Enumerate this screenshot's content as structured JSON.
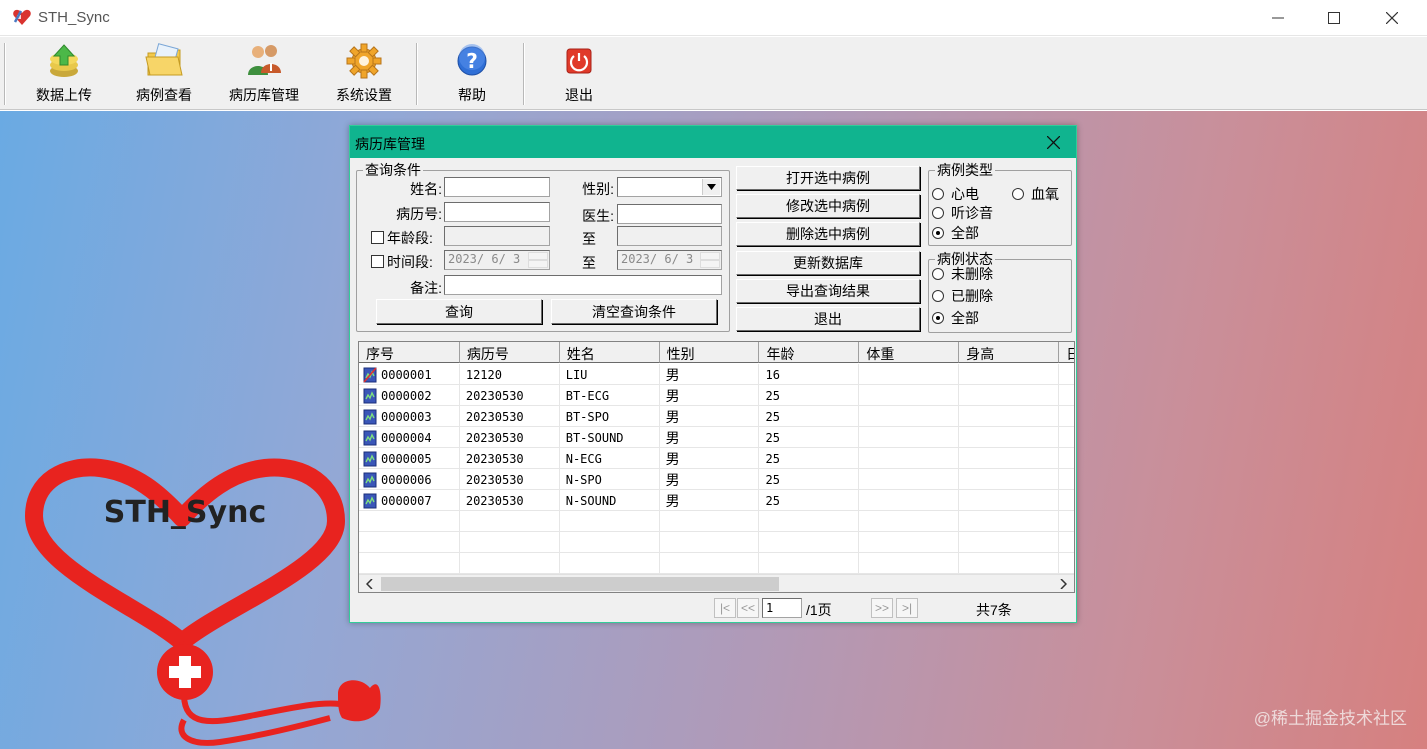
{
  "window": {
    "title": "STH_Sync"
  },
  "toolbar": {
    "upload": "数据上传",
    "view_cases": "病例查看",
    "records_mgmt": "病历库管理",
    "settings": "系统设置",
    "help": "帮助",
    "exit": "退出"
  },
  "logo": {
    "text": "STH_Sync"
  },
  "watermark": "@稀土掘金技术社区",
  "dialog": {
    "title": "病历库管理",
    "query": {
      "legend": "查询条件",
      "name_label": "姓名:",
      "name_value": "",
      "gender_label": "性别:",
      "gender_value": "",
      "record_no_label": "病历号:",
      "record_no_value": "",
      "doctor_label": "医生:",
      "doctor_value": "",
      "age_range_label": "年龄段:",
      "age_to_label": "至",
      "age_range_checked": false,
      "time_range_label": "时间段:",
      "time_to_label": "至",
      "time_range_checked": false,
      "time_from": "2023/ 6/ 3",
      "time_to": "2023/ 6/ 3",
      "remark_label": "备注:",
      "remark_value": "",
      "search_button": "查询",
      "clear_button": "清空查询条件"
    },
    "actions": {
      "open": "打开选中病例",
      "edit": "修改选中病例",
      "delete": "删除选中病例",
      "update_db": "更新数据库",
      "export": "导出查询结果",
      "exit": "退出"
    },
    "case_type": {
      "legend": "病例类型",
      "options": [
        "心电",
        "血氧",
        "听诊音",
        "全部"
      ],
      "selected": "全部"
    },
    "case_status": {
      "legend": "病例状态",
      "options": [
        "未删除",
        "已删除",
        "全部"
      ],
      "selected": "全部"
    },
    "grid": {
      "columns": [
        "序号",
        "病历号",
        "姓名",
        "性别",
        "年龄",
        "体重",
        "身高",
        "日"
      ],
      "rows": [
        {
          "id": "0000001",
          "record": "12120",
          "name": "LIU",
          "gender": "男",
          "age": "16",
          "weight": "",
          "height": ""
        },
        {
          "id": "0000002",
          "record": "20230530",
          "name": "BT-ECG",
          "gender": "男",
          "age": "25",
          "weight": "",
          "height": ""
        },
        {
          "id": "0000003",
          "record": "20230530",
          "name": "BT-SPO",
          "gender": "男",
          "age": "25",
          "weight": "",
          "height": ""
        },
        {
          "id": "0000004",
          "record": "20230530",
          "name": "BT-SOUND",
          "gender": "男",
          "age": "25",
          "weight": "",
          "height": ""
        },
        {
          "id": "0000005",
          "record": "20230530",
          "name": "N-ECG",
          "gender": "男",
          "age": "25",
          "weight": "",
          "height": ""
        },
        {
          "id": "0000006",
          "record": "20230530",
          "name": "N-SPO",
          "gender": "男",
          "age": "25",
          "weight": "",
          "height": ""
        },
        {
          "id": "0000007",
          "record": "20230530",
          "name": "N-SOUND",
          "gender": "男",
          "age": "25",
          "weight": "",
          "height": ""
        }
      ]
    },
    "pager": {
      "page_input": "1",
      "page_suffix": "/1页",
      "total": "共7条"
    }
  }
}
